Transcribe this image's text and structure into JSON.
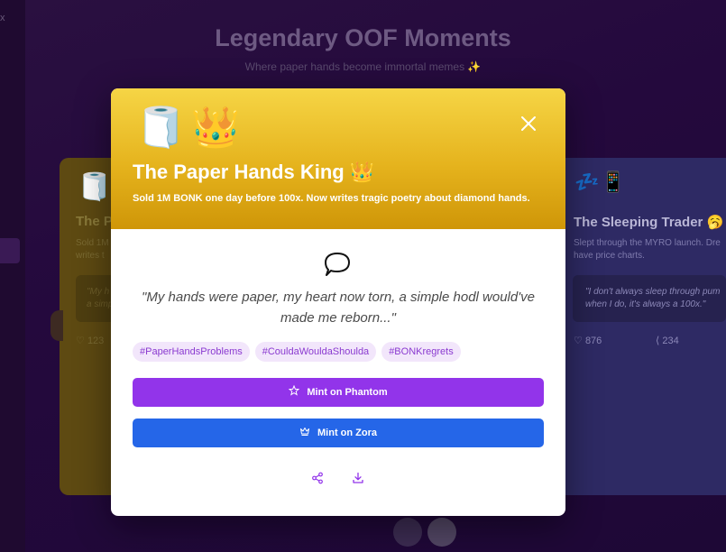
{
  "background": {
    "title": "Legendary OOF Moments",
    "subtitle": "Where paper hands become immortal memes ✨",
    "close_glyph": "x",
    "left_card": {
      "icon": "🧻",
      "title": "The P",
      "desc_line1": "Sold 1M",
      "desc_line2": "writes t",
      "quote_line1": "\"My h",
      "quote_line2": "a simp",
      "likes": "123"
    },
    "right_card": {
      "icon": "💤📱",
      "title": "The Sleeping Trader 🥱",
      "desc_line1": "Slept through the MYRO launch. Dre",
      "desc_line2": "have price charts.",
      "quote_line1": "\"I don't always sleep through pum",
      "quote_line2": "when I do, it's always a 100x.\"",
      "likes": "876",
      "shares": "234"
    }
  },
  "modal": {
    "emoji_1": "🧻",
    "emoji_2": "👑",
    "title": "The Paper Hands King 👑",
    "subtitle": "Sold 1M BONK one day before 100x. Now writes tragic poetry about diamond hands.",
    "bubble_icon": "🗯",
    "quote_line1": "\"My hands were paper, my heart now torn, a simple hodl would've",
    "quote_line2": "made me reborn...\"",
    "tags": [
      "#PaperHandsProblems",
      "#CouldaWouldaShoulda",
      "#BONKregrets"
    ],
    "mint_phantom": "Mint on Phantom",
    "mint_zora": "Mint on Zora"
  },
  "colors": {
    "header_top": "#f6d545",
    "header_bottom": "#cf9608",
    "phantom": "#9234ea",
    "zora": "#2566e8",
    "tag_bg": "#f2e6fb",
    "tag_text": "#8a3ad0"
  },
  "icons": {
    "close": "close-icon",
    "phantom_button": "star-icon",
    "zora_button": "crown-icon",
    "share": "share-icon",
    "download": "download-icon"
  }
}
